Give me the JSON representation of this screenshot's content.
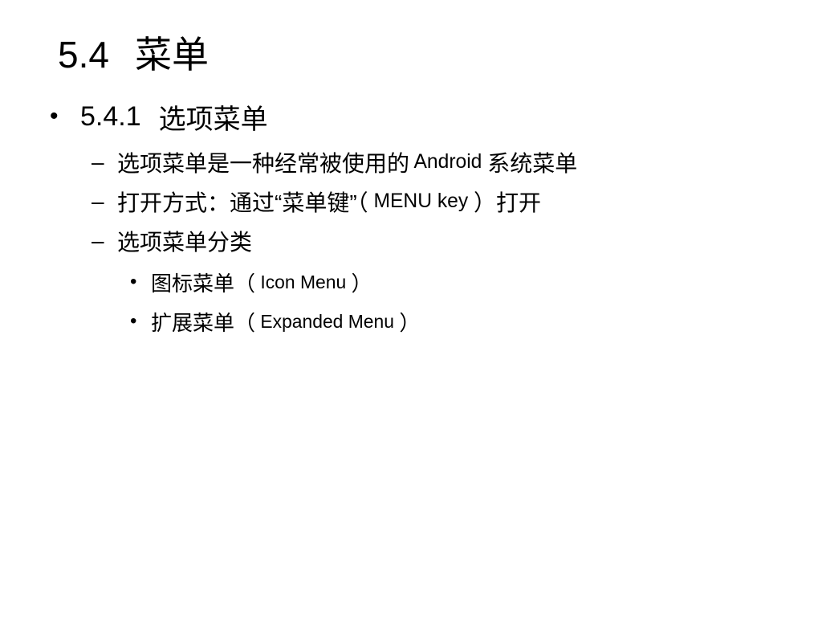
{
  "slide": {
    "title": {
      "number": "5.4",
      "text": "菜单"
    },
    "heading": {
      "bullet": "•",
      "number": "5.4.1",
      "text": "选项菜单"
    },
    "items": [
      {
        "bullet": "–",
        "segments": [
          "选项菜单是一种经常被使用的",
          " Android ",
          "系统菜单"
        ]
      },
      {
        "bullet": "–",
        "segments": [
          "打开方式：通过“菜单键”（",
          " MENU key ",
          "）打开"
        ]
      },
      {
        "bullet": "–",
        "segments": [
          "选项菜单分类"
        ]
      }
    ],
    "subitems": [
      {
        "bullet": "•",
        "segments": [
          "图标菜单（",
          " Icon Menu ",
          "）"
        ]
      },
      {
        "bullet": "•",
        "segments": [
          "扩展菜单（",
          " Expanded Menu ",
          "）"
        ]
      }
    ]
  }
}
